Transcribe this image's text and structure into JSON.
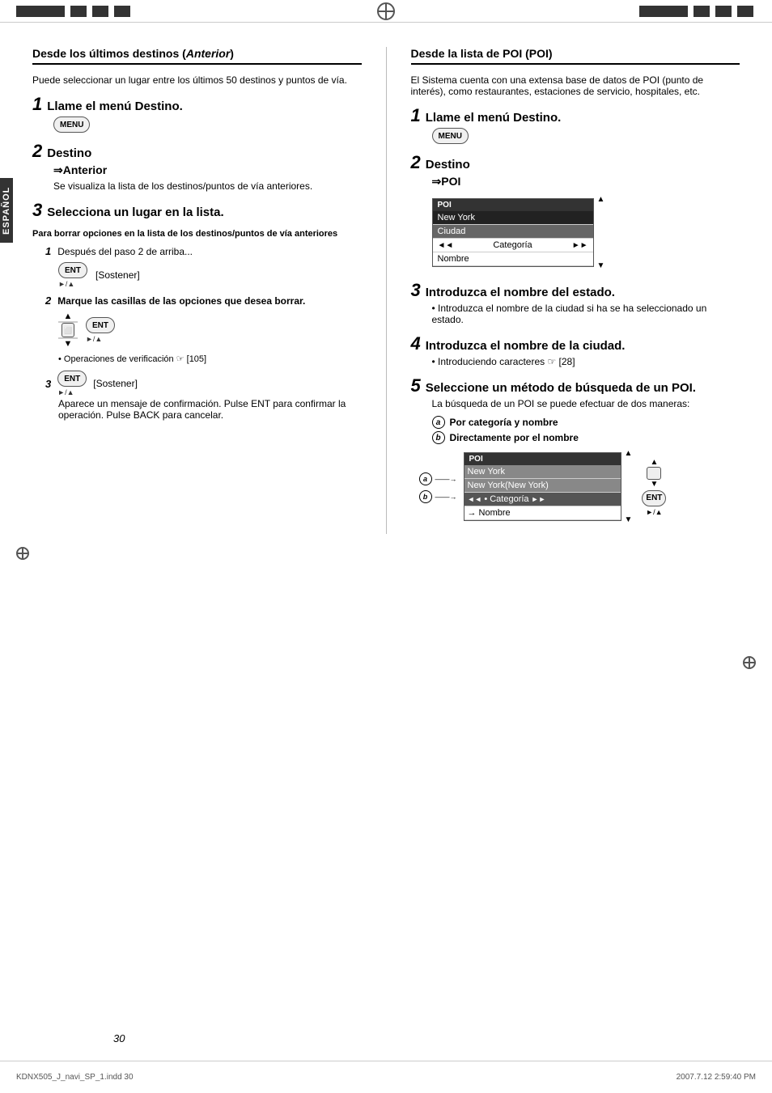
{
  "page": {
    "number": "30",
    "filename": "KDNX505_J_navi_SP_1.indd  30",
    "date": "2007.7.12   2:59:40 PM"
  },
  "side_label": "ESPAÑOL",
  "left_section": {
    "title": "Desde los últimos destinos (",
    "title_bold": "Anterior",
    "title_end": ")",
    "intro": "Puede seleccionar un lugar entre los últimos 50 destinos y puntos de vía.",
    "step1": {
      "num": "1",
      "text": "Llame el menú Destino."
    },
    "step2": {
      "num": "2",
      "line1": "Destino",
      "line2": "⇒Anterior",
      "body": "Se visualiza la lista de los destinos/puntos de vía anteriores."
    },
    "step3": {
      "num": "3",
      "text": "Selecciona un lugar en la lista."
    },
    "sub_section": {
      "heading": "Para borrar opciones en la lista de los destinos/puntos de vía anteriores",
      "sub1": {
        "num": "1",
        "text": "Después del paso 2 de arriba...",
        "key": "ENT",
        "key_label": "[Sostener]",
        "sub_arrow": "►/▲"
      },
      "sub2": {
        "num": "2",
        "text": "Marque las casillas de las opciones que desea borrar.",
        "bullet": "Operaciones de verificación ☞ [105]",
        "key": "ENT",
        "sub_arrow": "►/▲"
      },
      "sub3": {
        "num": "3",
        "key": "ENT",
        "key_label": "[Sostener]",
        "sub_arrow": "►/▲",
        "body": "Aparece un mensaje de confirmación. Pulse ENT para confirmar la operación. Pulse BACK para cancelar."
      }
    }
  },
  "right_section": {
    "title": "Desde la lista de POI (",
    "title_bold": "POI",
    "title_end": ")",
    "intro": "El Sistema cuenta con una extensa base de datos de POI (punto de interés), como restaurantes, estaciones de servicio, hospitales, etc.",
    "step1": {
      "num": "1",
      "text": "Llame el menú Destino."
    },
    "step2": {
      "num": "2",
      "line1": "Destino",
      "line2": "⇒POI"
    },
    "poi_screen": {
      "header": "POI",
      "rows": [
        {
          "text": "New York",
          "highlighted": true
        },
        {
          "text": "Ciudad",
          "selected": true
        },
        {
          "text": "Categoría",
          "has_arrows": true
        },
        {
          "text": "Nombre"
        }
      ]
    },
    "step3": {
      "num": "3",
      "text": "Introduzca el nombre del estado."
    },
    "step3_bullet": "Introduzca el nombre de la ciudad si ha se ha seleccionado un estado.",
    "step4": {
      "num": "4",
      "text": "Introduzca el nombre de la ciudad."
    },
    "step4_bullet": "Introduciendo caracteres ☞ [28]",
    "step5": {
      "num": "5",
      "text": "Seleccione un método de búsqueda de un POI."
    },
    "step5_body": "La búsqueda de un POI se puede efectuar de dos maneras:",
    "method_a": {
      "label": "a",
      "text": "Por categoría y nombre"
    },
    "method_b": {
      "label": "b",
      "text": "Directamente por el nombre"
    },
    "poi_screen2": {
      "header": "POI",
      "rows": [
        {
          "text": "New York",
          "type": "highlighted"
        },
        {
          "text": "New York(New York)",
          "type": "highlighted"
        },
        {
          "text": "• Categoría",
          "type": "selected",
          "has_arrows": true,
          "ref": "a"
        },
        {
          "text": "→ Nombre",
          "type": "normal",
          "ref": "b"
        }
      ]
    }
  }
}
